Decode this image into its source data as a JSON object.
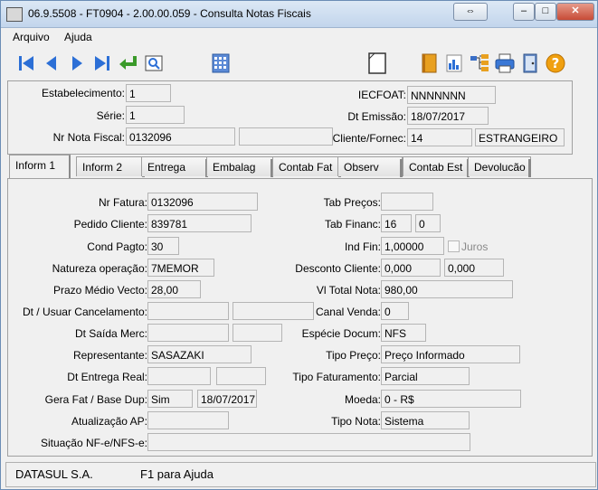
{
  "window": {
    "title": "06.9.5508 - FT0904 - 2.00.00.059 - Consulta Notas Fiscais",
    "buttons": {
      "restore": "⇔",
      "minimize": "–",
      "maximize": "□",
      "close": "✕"
    }
  },
  "menu": {
    "arquivo": "Arquivo",
    "ajuda": "Ajuda"
  },
  "toolbar": {
    "icons": [
      "first-icon",
      "prev-icon",
      "next-icon",
      "last-icon",
      "return-icon",
      "zoom-icon",
      "calendar-icon",
      "new-document-icon",
      "book-icon",
      "chart-icon",
      "tree-icon",
      "print-icon",
      "exit-door-icon",
      "help-icon"
    ],
    "colors": {
      "nav": "#2c6fd6",
      "return": "#3a9a2a",
      "help": "#f0a010"
    }
  },
  "header": {
    "estabelecimento_label": "Estabelecimento:",
    "estabelecimento_value": "1",
    "serie_label": "Série:",
    "serie_value": "1",
    "nr_nota_label": "Nr Nota Fiscal:",
    "nr_nota_value": "0132096",
    "nr_nota_extra": "",
    "iecfoat_label": "IECFOAT:",
    "iecfoat_value": "NNNNNNN",
    "dt_emissao_label": "Dt Emissão:",
    "dt_emissao_value": "18/07/2017",
    "cliente_label": "Cliente/Fornec:",
    "cliente_code": "14",
    "cliente_name": "ESTRANGEIRO"
  },
  "tabs": [
    "Inform 1",
    "Inform 2",
    "Entrega",
    "Embalag",
    "Contab Fat",
    "Observ",
    "Contab Est",
    "Devolucão"
  ],
  "form": {
    "nr_fatura_label": "Nr Fatura:",
    "nr_fatura": "0132096",
    "pedido_label": "Pedido Cliente:",
    "pedido": "839781",
    "cond_pagto_label": "Cond Pagto:",
    "cond_pagto": "30",
    "natureza_label": "Natureza operação:",
    "natureza": "7MEMOR",
    "prazo_label": "Prazo Médio Vecto:",
    "prazo": "28,00",
    "dt_cancel_label": "Dt / Usuar Cancelamento:",
    "dt_cancel": "",
    "usuar_cancel": "",
    "dt_saida_label": "Dt Saída Merc:",
    "dt_saida": "",
    "dt_saida_extra": "",
    "representante_label": "Representante:",
    "representante": "SASAZAKI",
    "dt_entrega_label": "Dt Entrega Real:",
    "dt_entrega": "",
    "dt_entrega_extra": "",
    "gera_fat_label": "Gera Fat / Base Dup:",
    "gera_fat": "Sim",
    "base_dup": "18/07/2017",
    "atualizacao_label": "Atualização AP:",
    "atualizacao": "",
    "situacao_label": "Situação NF-e/NFS-e:",
    "situacao": "",
    "tab_precos_label": "Tab Preços:",
    "tab_precos": "",
    "tab_financ_label": "Tab Financ:",
    "tab_financ_1": "16",
    "tab_financ_2": "0",
    "ind_fin_label": "Ind Fin:",
    "ind_fin": "1,00000",
    "juros_label": "Juros",
    "desconto_label": "Desconto Cliente:",
    "desconto_1": "0,000",
    "desconto_2": "0,000",
    "vl_total_label": "Vl Total Nota:",
    "vl_total": "980,00",
    "canal_label": "Canal Venda:",
    "canal": "0",
    "especie_label": "Espécie Docum:",
    "especie": "NFS",
    "tipo_preco_label": "Tipo Preço:",
    "tipo_preco": "Preço Informado",
    "tipo_fat_label": "Tipo Faturamento:",
    "tipo_fat": "Parcial",
    "moeda_label": "Moeda:",
    "moeda": "0 - R$",
    "tipo_nota_label": "Tipo Nota:",
    "tipo_nota": "Sistema"
  },
  "status": {
    "company": "DATASUL S.A.",
    "help": "F1 para Ajuda"
  }
}
